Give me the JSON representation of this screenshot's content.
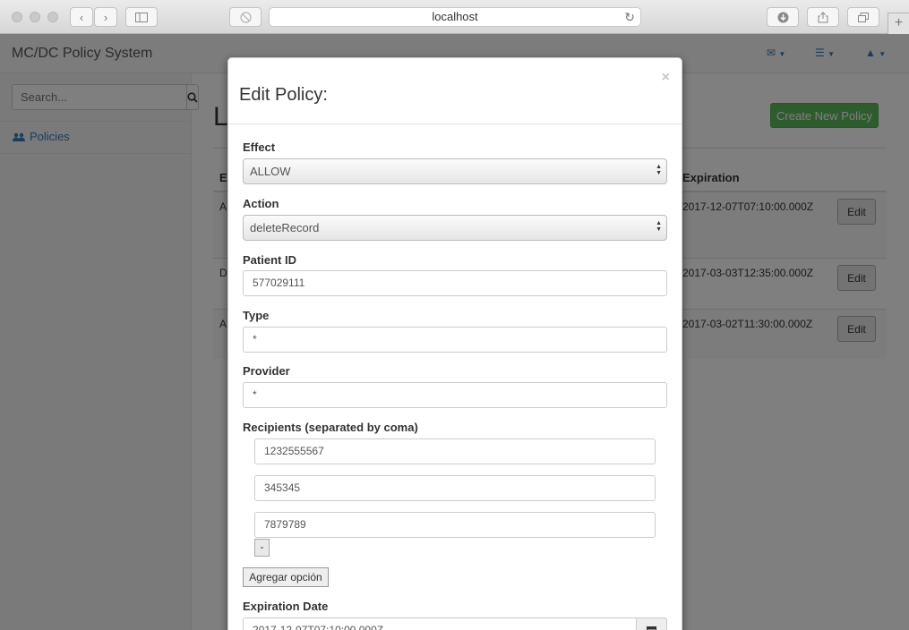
{
  "browser": {
    "url": "localhost"
  },
  "app": {
    "brand": "MC/DC Policy System",
    "search_placeholder": "Search...",
    "nav_policies": "Policies",
    "page_title_partial": "L",
    "create_button": "Create New Policy",
    "table": {
      "col_first_partial": "E",
      "col_expiration": "Expiration",
      "rows": [
        {
          "first_partial": "A",
          "expiration": "2017-12-07T07:10:00.000Z",
          "edit": "Edit"
        },
        {
          "first_partial": "D",
          "expiration": "2017-03-03T12:35:00.000Z",
          "edit": "Edit"
        },
        {
          "first_partial": "A",
          "expiration": "2017-03-02T11:30:00.000Z",
          "edit": "Edit"
        }
      ]
    }
  },
  "modal": {
    "title": "Edit Policy:",
    "close": "×",
    "effect_label": "Effect",
    "effect_value": "ALLOW",
    "action_label": "Action",
    "action_value": "deleteRecord",
    "patient_label": "Patient ID",
    "patient_value": "577029111",
    "type_label": "Type",
    "type_value": "*",
    "provider_label": "Provider",
    "provider_value": "*",
    "recipients_label": "Recipients (separated by coma)",
    "recipients": [
      "1232555567",
      "345345",
      "7879789"
    ],
    "remove_label": "-",
    "add_option_label": "Agregar opción",
    "expiration_label": "Expiration Date",
    "expiration_value": "2017-12-07T07:10:00.000Z"
  }
}
